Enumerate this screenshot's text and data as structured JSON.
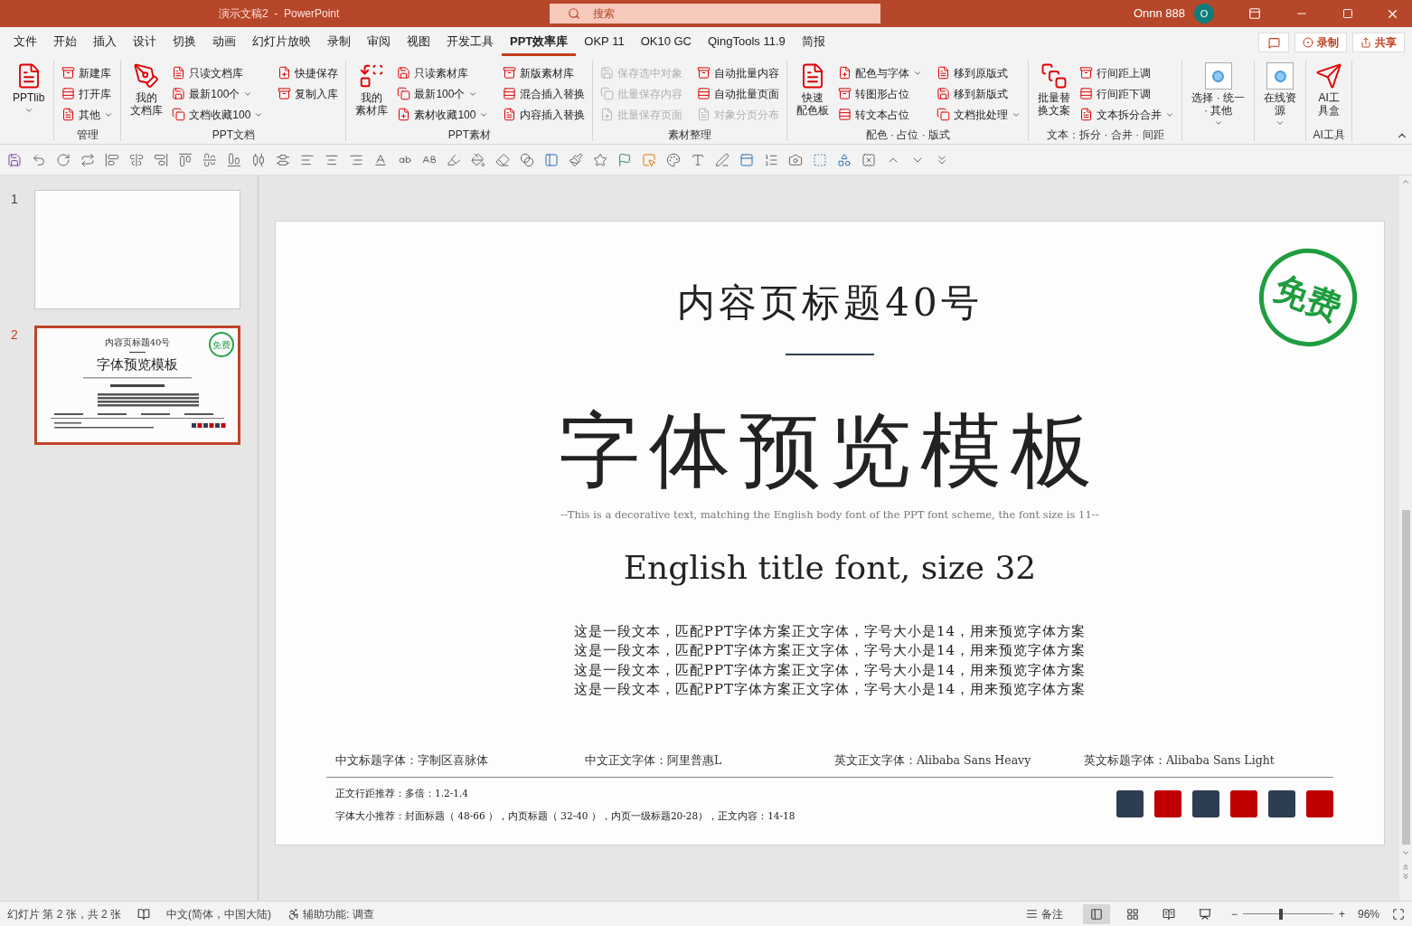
{
  "title_bar": {
    "title": "演示文稿2  -  PowerPoint",
    "search_placeholder": "搜索",
    "user": "Onnn 888",
    "avatar": "O"
  },
  "menu_tabs": [
    {
      "label": "文件",
      "selected": false
    },
    {
      "label": "开始",
      "selected": false
    },
    {
      "label": "插入",
      "selected": false
    },
    {
      "label": "设计",
      "selected": false
    },
    {
      "label": "切换",
      "selected": false
    },
    {
      "label": "动画",
      "selected": false
    },
    {
      "label": "幻灯片放映",
      "selected": false
    },
    {
      "label": "录制",
      "selected": false
    },
    {
      "label": "审阅",
      "selected": false
    },
    {
      "label": "视图",
      "selected": false
    },
    {
      "label": "开发工具",
      "selected": false
    },
    {
      "label": "PPT效率库",
      "selected": true
    },
    {
      "label": "OKP 11",
      "selected": false
    },
    {
      "label": "OK10 GC",
      "selected": false
    },
    {
      "label": "QingTools 11.9",
      "selected": false
    },
    {
      "label": "简报",
      "selected": false
    }
  ],
  "header_buttons": [
    {
      "kind": "comment"
    },
    {
      "kind": "record",
      "label": "录制"
    },
    {
      "kind": "share",
      "label": "共享"
    }
  ],
  "ribbon_groups": [
    {
      "items": [
        {
          "kind": "large",
          "label_lines": [
            "PPTlib"
          ],
          "dropdown": true,
          "disabled": false
        }
      ]
    },
    {
      "label": "管理",
      "items": [
        {
          "kind": "small",
          "label": "新建库",
          "dropdown": false,
          "disabled": false
        },
        {
          "kind": "small",
          "label": "打开库",
          "dropdown": false,
          "disabled": false
        },
        {
          "kind": "small",
          "label": "其他",
          "dropdown": true,
          "disabled": false
        }
      ]
    },
    {
      "label": "PPT文档",
      "items": [
        {
          "kind": "large",
          "label_lines": [
            "我的",
            "文档库"
          ],
          "dropdown": false,
          "disabled": false
        },
        {
          "kind": "small",
          "label": "只读文档库",
          "dropdown": false,
          "disabled": false
        },
        {
          "kind": "small",
          "label": "最新100个",
          "dropdown": true,
          "disabled": false
        },
        {
          "kind": "small",
          "label": "文档收藏100",
          "dropdown": true,
          "disabled": false
        },
        {
          "kind": "small",
          "label": "快捷保存",
          "dropdown": false,
          "disabled": false
        },
        {
          "kind": "small",
          "label": "复制入库",
          "dropdown": false,
          "disabled": false
        }
      ]
    },
    {
      "label": "PPT素材",
      "items": [
        {
          "kind": "large",
          "label_lines": [
            "我的",
            "素材库"
          ],
          "dropdown": false,
          "disabled": false
        },
        {
          "kind": "small",
          "label": "只读素材库",
          "dropdown": false,
          "disabled": false
        },
        {
          "kind": "small",
          "label": "最新100个",
          "dropdown": true,
          "disabled": false
        },
        {
          "kind": "small",
          "label": "素材收藏100",
          "dropdown": true,
          "disabled": false
        },
        {
          "kind": "small",
          "label": "新版素材库",
          "dropdown": false,
          "disabled": false
        },
        {
          "kind": "small",
          "label": "混合插入替换",
          "dropdown": false,
          "disabled": false
        },
        {
          "kind": "small",
          "label": "内容插入替换",
          "dropdown": false,
          "disabled": false
        }
      ]
    },
    {
      "label": "素材整理",
      "items": [
        {
          "kind": "small",
          "label": "保存选中对象",
          "dropdown": false,
          "disabled": true
        },
        {
          "kind": "small",
          "label": "批量保存内容",
          "dropdown": false,
          "disabled": true
        },
        {
          "kind": "small",
          "label": "批量保存页面",
          "dropdown": false,
          "disabled": true
        },
        {
          "kind": "small",
          "label": "自动批量内容",
          "dropdown": false,
          "disabled": false
        },
        {
          "kind": "small",
          "label": "自动批量页面",
          "dropdown": false,
          "disabled": false
        },
        {
          "kind": "small",
          "label": "对象分页分布",
          "dropdown": false,
          "disabled": true
        }
      ]
    },
    {
      "label": "配色 · 占位 · 版式",
      "items": [
        {
          "kind": "large",
          "label_lines": [
            "快速",
            "配色板"
          ],
          "dropdown": false,
          "disabled": false
        },
        {
          "kind": "small",
          "label": "配色与字体",
          "dropdown": true,
          "disabled": false
        },
        {
          "kind": "small",
          "label": "转图形占位",
          "dropdown": false,
          "disabled": false
        },
        {
          "kind": "small",
          "label": "转文本占位",
          "dropdown": false,
          "disabled": false
        },
        {
          "kind": "small",
          "label": "移到原版式",
          "dropdown": false,
          "disabled": false
        },
        {
          "kind": "small",
          "label": "移到新版式",
          "dropdown": false,
          "disabled": false
        },
        {
          "kind": "small",
          "label": "文档批处理",
          "dropdown": true,
          "disabled": false
        }
      ]
    },
    {
      "label": "文本：拆分 · 合并 · 间距",
      "items": [
        {
          "kind": "large",
          "label_lines": [
            "批量替",
            "换文案"
          ],
          "dropdown": false,
          "disabled": false
        },
        {
          "kind": "small",
          "label": "行间距上调",
          "dropdown": false,
          "disabled": false
        },
        {
          "kind": "small",
          "label": "行间距下调",
          "dropdown": false,
          "disabled": false
        },
        {
          "kind": "small",
          "label": "文本拆分合并",
          "dropdown": true,
          "disabled": false
        }
      ]
    },
    {
      "items": [
        {
          "kind": "boxed",
          "label_lines": [
            "选择 · 统一",
            "· 其他"
          ],
          "dropdown": true,
          "disabled": false
        }
      ]
    },
    {
      "items": [
        {
          "kind": "boxed",
          "label_lines": [
            "在线资",
            "源"
          ],
          "dropdown": true,
          "disabled": false
        }
      ]
    },
    {
      "label": "AI工具",
      "items": [
        {
          "kind": "large",
          "label_lines": [
            "AI工",
            "具盒"
          ],
          "dropdown": false,
          "disabled": false
        }
      ]
    }
  ],
  "slides": [
    {
      "number": "1",
      "selected": false
    },
    {
      "number": "2",
      "selected": true,
      "title": "内容页标题40号",
      "heading": "字体预览模板",
      "stamp": "免费"
    }
  ],
  "slide": {
    "stamp": "免费",
    "title": "内容页标题40号",
    "heading": "字体预览模板",
    "decorative": "--This is a decorative text, matching the English body font of the PPT font scheme, the font size is 11--",
    "english_title": "English title font, size 32",
    "body": [
      "这是一段文本，匹配PPT字体方案正文字体，字号大小是14，用来预览字体方案",
      "这是一段文本，匹配PPT字体方案正文字体，字号大小是14，用来预览字体方案",
      "这是一段文本，匹配PPT字体方案正文字体，字号大小是14，用来预览字体方案",
      "这是一段文本，匹配PPT字体方案正文字体，字号大小是14，用来预览字体方案"
    ],
    "fonts": [
      "中文标题字体：字制区喜脉体",
      "中文正文字体：阿里普惠L",
      "英文正文字体：Alibaba Sans Heavy",
      "英文标题字体：Alibaba Sans Light"
    ],
    "notes": [
      "正文行距推荐：多倍：1.2-1.4",
      "字体大小推荐：封面标题（ 48-66 ），内页标题（ 32-40 ），内页一级标题20-28），正文内容：14-18"
    ],
    "swatches": [
      {
        "color": "#2e3e52"
      },
      {
        "color": "#c00000"
      },
      {
        "color": "#2e3e52"
      },
      {
        "color": "#c00000"
      },
      {
        "color": "#2e3e52"
      },
      {
        "color": "#c00000"
      }
    ]
  },
  "status_bar": {
    "slide_info": "幻灯片 第 2 张，共 2 张",
    "language": "中文(简体，中国大陆)",
    "accessibility": "辅助功能: 调查",
    "notes": "备注",
    "zoom_minus": "−",
    "zoom_plus": "+",
    "zoom": {
      "level": 0.42
    },
    "zoom_percent": "96%"
  }
}
